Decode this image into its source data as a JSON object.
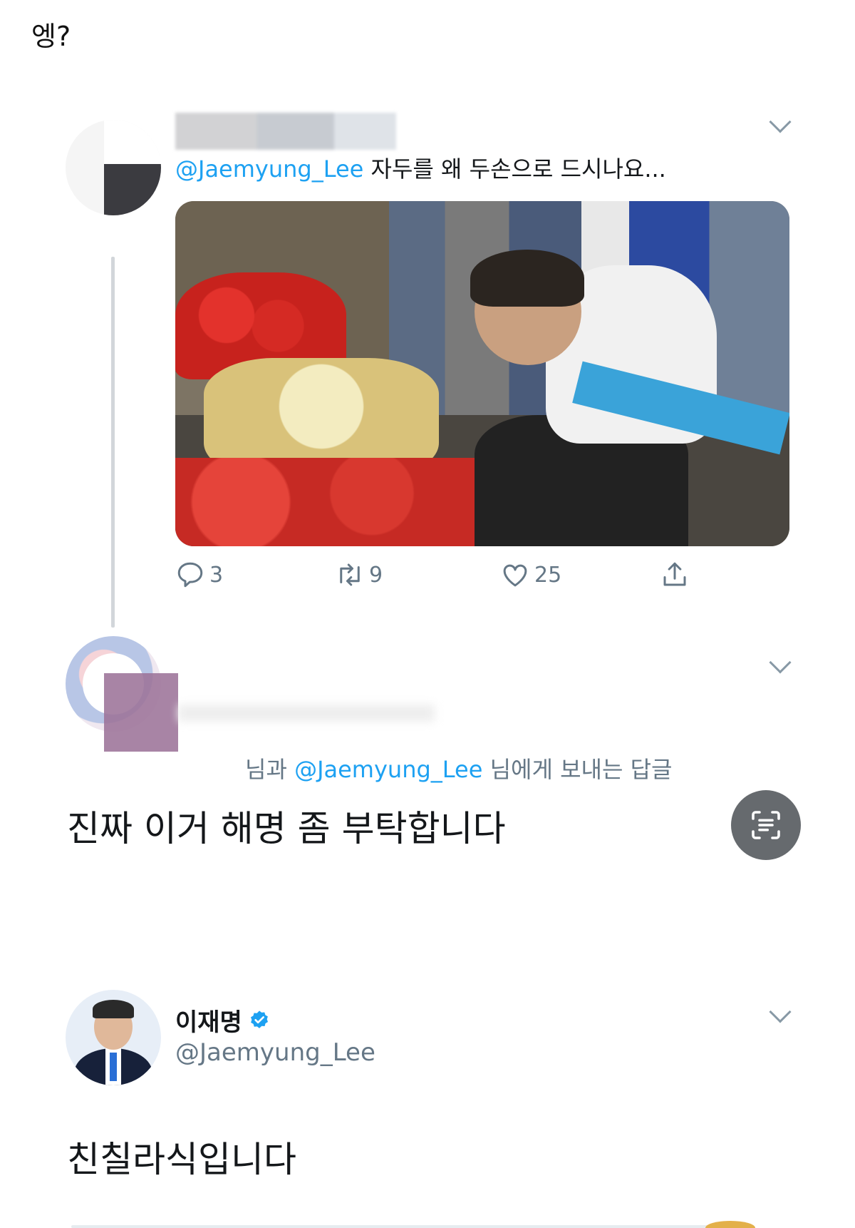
{
  "caption": "엥?",
  "tweet1": {
    "mention": "@Jaemyung_Lee",
    "text": " 자두를 왜 두손으로 드시나요...",
    "actions": {
      "replies": "3",
      "retweets": "9",
      "likes": "25"
    }
  },
  "tweet2": {
    "reply_to_prefix": "님과 ",
    "reply_to_mention": "@Jaemyung_Lee",
    "reply_to_suffix": " 님에게 보내는 답글",
    "text": "진짜 이거 해명 좀 부탁합니다"
  },
  "tweet3": {
    "display_name": "이재명",
    "handle": "@Jaemyung_Lee",
    "text": "친칠라식입니다"
  },
  "icons": {
    "reply": "comment-icon",
    "retweet": "retweet-icon",
    "like": "heart-icon",
    "share": "share-icon",
    "more": "chevron-down-icon",
    "scan": "text-scan-icon",
    "verified": "verified-badge-icon"
  },
  "colors": {
    "mention": "#1da1f2",
    "secondary_text": "#657786",
    "verified": "#1da1f2"
  }
}
